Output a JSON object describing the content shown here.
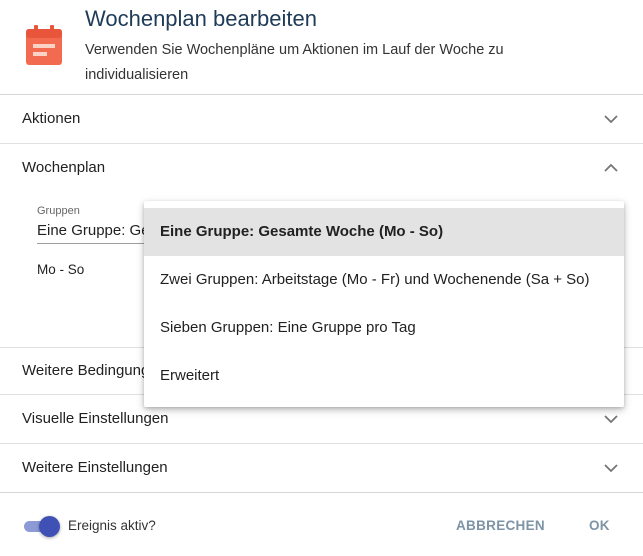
{
  "header": {
    "title": "Wochenplan bearbeiten",
    "subtitle": "Verwenden Sie Wochenpläne um Aktionen im Lauf der Woche zu individualisieren",
    "icon": "calendar-icon"
  },
  "sections": {
    "aktionen": "Aktionen",
    "wochenplan": "Wochenplan",
    "weitere_bedingungen": "Weitere Bedingungen",
    "visuelle_einstellungen": "Visuelle Einstellungen",
    "weitere_einstellungen": "Weitere Einstellungen"
  },
  "wochenplan": {
    "field_label": "Gruppen",
    "field_value": "Eine Gruppe: Gesamte Woche (Mo - So)",
    "day_label": "Mo - So"
  },
  "dropdown": {
    "options": [
      "Eine Gruppe: Gesamte Woche (Mo - So)",
      "Zwei Gruppen: Arbeitstage (Mo - Fr) und Wochenende (Sa + So)",
      "Sieben Gruppen: Eine Gruppe pro Tag",
      "Erweitert"
    ],
    "selected_index": 0
  },
  "footer": {
    "toggle_label": "Ereignis aktiv?",
    "toggle_on": true,
    "cancel_label": "ABBRECHEN",
    "ok_label": "OK"
  },
  "colors": {
    "title": "#1f3b57",
    "icon": "#e8553a",
    "toggle": "#3f51b5",
    "button": "#7d93a6"
  }
}
